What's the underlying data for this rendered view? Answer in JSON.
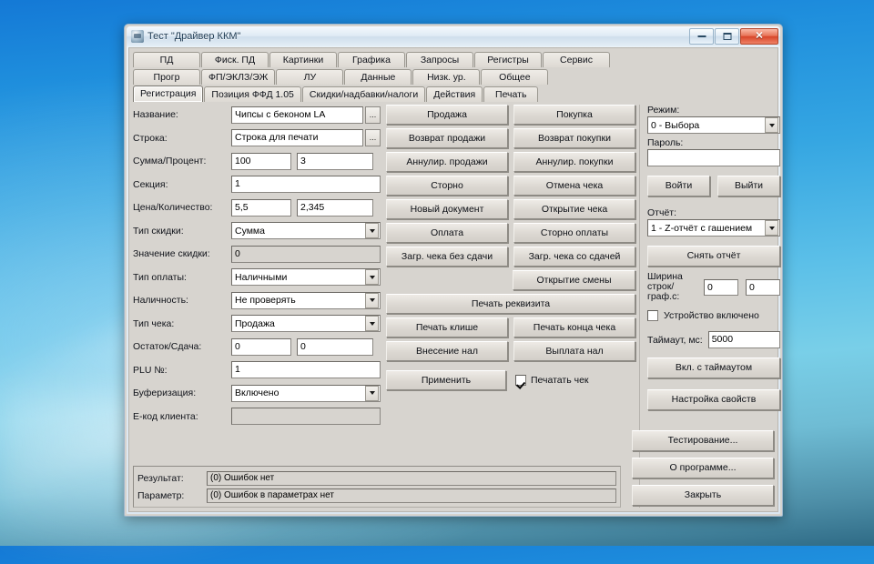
{
  "window": {
    "title": "Тест \"Драйвер ККМ\"",
    "icon": "app-icon",
    "minimize_label": "",
    "maximize_label": "",
    "close_label": "✕"
  },
  "tabs": {
    "row1": [
      {
        "label": "ПД",
        "selected": false
      },
      {
        "label": "Фиск. ПД",
        "selected": false
      },
      {
        "label": "Картинки",
        "selected": false
      },
      {
        "label": "Графика",
        "selected": false
      },
      {
        "label": "Запросы",
        "selected": false
      },
      {
        "label": "Регистры",
        "selected": false
      },
      {
        "label": "Сервис",
        "selected": false
      }
    ],
    "row2": [
      {
        "label": "Прогр",
        "selected": false
      },
      {
        "label": "ФП/ЭКЛЗ/ЭЖ",
        "selected": false
      },
      {
        "label": "ЛУ",
        "selected": false
      },
      {
        "label": "Данные",
        "selected": false
      },
      {
        "label": "Низк. ур.",
        "selected": false
      },
      {
        "label": "Общее",
        "selected": false
      }
    ],
    "row3": [
      {
        "label": "Регистрация",
        "selected": true
      },
      {
        "label": "Позиция ФФД 1.05",
        "selected": false
      },
      {
        "label": "Скидки/надбавки/налоги",
        "selected": false
      },
      {
        "label": "Действия",
        "selected": false
      },
      {
        "label": "Печать",
        "selected": false
      }
    ]
  },
  "form": {
    "name_label": "Название:",
    "name_value": "Чипсы с беконом LA",
    "name_browse": "...",
    "string_label": "Строка:",
    "string_value": "Строка для печати",
    "string_browse": "...",
    "sum_percent_label": "Сумма/Процент:",
    "sum_value": "100",
    "percent_value": "3",
    "section_label": "Секция:",
    "section_value": "1",
    "price_qty_label": "Цена/Количество:",
    "price_value": "5,5",
    "qty_value": "2,345",
    "discount_type_label": "Тип скидки:",
    "discount_type_value": "Сумма",
    "discount_value_label": "Значение скидки:",
    "discount_value": "0",
    "payment_type_label": "Тип оплаты:",
    "payment_type_value": "Наличными",
    "availability_label": "Наличность:",
    "availability_value": "Не проверять",
    "check_type_label": "Тип чека:",
    "check_type_value": "Продажа",
    "rest_change_label": "Остаток/Сдача:",
    "rest_value": "0",
    "change_value": "0",
    "plu_label": "PLU №:",
    "plu_value": "1",
    "buffer_label": "Буферизация:",
    "buffer_value": "Включено",
    "ecode_label": "E-код клиента:",
    "ecode_value": ""
  },
  "actions": {
    "rows": [
      [
        "Продажа",
        "Покупка"
      ],
      [
        "Возврат продажи",
        "Возврат покупки"
      ],
      [
        "Аннулир. продажи",
        "Аннулир. покупки"
      ],
      [
        "Сторно",
        "Отмена чека"
      ],
      [
        "Новый документ",
        "Открытие чека"
      ],
      [
        "Оплата",
        "Сторно оплаты"
      ],
      [
        "Загр. чека без сдачи",
        "Загр. чека со сдачей"
      ]
    ],
    "open_shift": "Открытие смены",
    "print_props": "Печать реквизита",
    "print_clishe": "Печать клише",
    "print_end": "Печать конца чека",
    "cash_in": "Внесение нал",
    "cash_out": "Выплата нал",
    "apply": "Применить",
    "print_check_label": "Печатать чек",
    "print_check_checked": true
  },
  "right": {
    "mode_label": "Режим:",
    "mode_value": "0 - Выбора",
    "password_label": "Пароль:",
    "password_value": "",
    "login": "Войти",
    "logout": "Выйти",
    "report_label": "Отчёт:",
    "report_value": "1 - Z-отчёт с гашением",
    "take_report": "Снять отчёт",
    "width_label_line1": "Ширина",
    "width_label_line2": "строк/граф.с:",
    "width_value1": "0",
    "width_value2": "0",
    "device_on_label": "Устройство включено",
    "device_on_checked": false,
    "timeout_label": "Таймаут, мс:",
    "timeout_value": "5000",
    "enable_timeout": "Вкл. с таймаутом",
    "settings": "Настройка свойств",
    "test": "Тестирование...",
    "about": "О программе...",
    "close": "Закрыть"
  },
  "status": {
    "result_label": "Результат:",
    "result_value": "(0) Ошибок нет",
    "params_label": "Параметр:",
    "params_value": "(0) Ошибок в параметрах нет"
  },
  "colors": {
    "desktop_top": "#1479d6",
    "desktop_mid": "#5cc0e8",
    "desktop_bottom": "#2f6b86",
    "window_face": "#d7d4cf",
    "title_text": "#1d3a52",
    "close_button": "#d8462a"
  }
}
